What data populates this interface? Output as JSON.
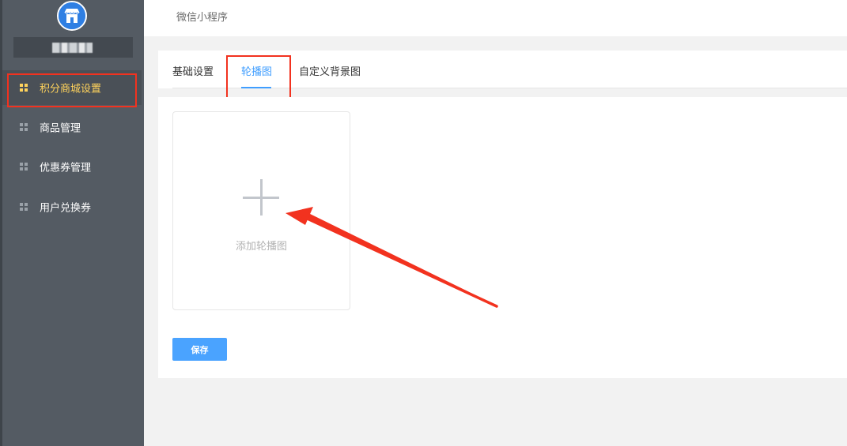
{
  "sidebar": {
    "account_name": "",
    "items": [
      {
        "label": "积分商城设置",
        "active": true
      },
      {
        "label": "商品管理",
        "active": false
      },
      {
        "label": "优惠券管理",
        "active": false
      },
      {
        "label": "用户兑换券",
        "active": false
      }
    ]
  },
  "header": {
    "breadcrumb": "微信小程序"
  },
  "tabs": [
    {
      "label": "基础设置",
      "active": false
    },
    {
      "label": "轮播图",
      "active": true
    },
    {
      "label": "自定义背景图",
      "active": false
    }
  ],
  "carousel": {
    "add_label": "添加轮播图",
    "icon": "plus-icon"
  },
  "actions": {
    "save_label": "保存"
  },
  "colors": {
    "sidebar_bg": "#545b63",
    "active_nav": "#ffd35c",
    "accent": "#409eff",
    "annotation": "#f2321f"
  }
}
